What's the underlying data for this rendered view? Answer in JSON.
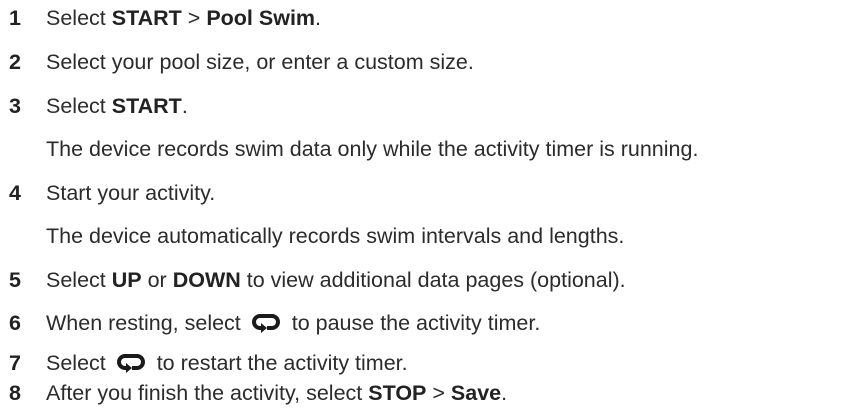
{
  "steps": [
    {
      "number": "1",
      "text_before": "Select ",
      "bold1": "START",
      "sep": " > ",
      "bold2": "Pool Swim",
      "text_after": "."
    },
    {
      "number": "2",
      "text": "Select your pool size, or enter a custom size."
    },
    {
      "number": "3",
      "text_before": "Select ",
      "bold1": "START",
      "text_after": ".",
      "note": "The device records swim data only while the activity timer is running."
    },
    {
      "number": "4",
      "text": "Start your activity.",
      "note": "The device automatically records swim intervals and lengths."
    },
    {
      "number": "5",
      "text_before": "Select ",
      "bold1": "UP",
      "sep": " or ",
      "bold2": "DOWN",
      "text_after": " to view additional data pages (optional)."
    },
    {
      "number": "6",
      "text_before": "When resting, select ",
      "icon": "lap-loop-icon",
      "text_after": " to pause the activity timer."
    },
    {
      "number": "7",
      "text_before": "Select ",
      "icon": "lap-loop-icon",
      "text_after": " to restart the activity timer."
    },
    {
      "number": "8",
      "text_before": "After you finish the activity, select ",
      "bold1": "STOP",
      "sep": " > ",
      "bold2": "Save",
      "text_after": "."
    }
  ],
  "colors": {
    "text": "#2b2b2b",
    "icon": "#1a1a1a"
  }
}
